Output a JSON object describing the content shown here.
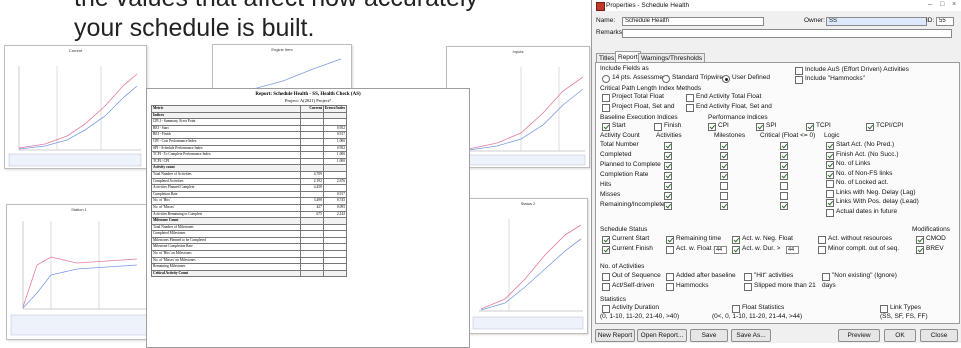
{
  "slide": {
    "title_partial": "your schedule is built.",
    "title_cut": "the values that affect how accurately"
  },
  "thumbnails": [
    {
      "title": "Current"
    },
    {
      "title": "Engine Item"
    },
    {
      "title": "Inputs"
    },
    {
      "title": "Station 1"
    },
    {
      "title": "Status 2"
    }
  ],
  "report": {
    "title": "Report: Schedule Health - SS, Health Check (AS)",
    "subtitle": "Project: A(2021) Project?",
    "col_metric": "Metric",
    "col_current": "Current",
    "col_prev": "Errors/Index",
    "rows": [
      {
        "label": "Indices",
        "cur": "",
        "prev": "",
        "sec": true
      },
      {
        "label": "CPLI - Summary, Error Point",
        "cur": "",
        "prev": ""
      },
      {
        "label": "BEI - Start",
        "cur": "",
        "prev": "0.952"
      },
      {
        "label": "BEI - Finish",
        "cur": "",
        "prev": "0.917"
      },
      {
        "label": "CPI - Cost Performance Index",
        "cur": "",
        "prev": "1.000"
      },
      {
        "label": "SPI - Schedule Performance Index",
        "cur": "",
        "prev": "0.952"
      },
      {
        "label": "TCPI - To Complete Performance Index",
        "cur": "",
        "prev": "1.000"
      },
      {
        "label": "TCPI / CPI",
        "cur": "",
        "prev": "1.000"
      },
      {
        "label": "Activity count",
        "cur": "",
        "prev": "",
        "sec": true
      },
      {
        "label": "Total Number of Activities",
        "cur": "4,709",
        "prev": ""
      },
      {
        "label": "Completed Activities",
        "cur": "2,192",
        "prev": "2,676"
      },
      {
        "label": "Activities Planned Complete",
        "cur": "4,458",
        "prev": ""
      },
      {
        "label": "Completion Rate",
        "cur": "",
        "prev": "0.917"
      },
      {
        "label": "No. of 'Hits'",
        "cur": "3,498",
        "prev": "0.745"
      },
      {
        "label": "No. of 'Misses'",
        "cur": "427",
        "prev": "0.095"
      },
      {
        "label": "Activities Remaining to Complete",
        "cur": "675",
        "prev": "2,142"
      },
      {
        "label": "Milestone Count",
        "cur": "",
        "prev": "",
        "sec": true
      },
      {
        "label": "Total Number of Milestones",
        "cur": "",
        "prev": ""
      },
      {
        "label": "Completed Milestones",
        "cur": "",
        "prev": ""
      },
      {
        "label": "Milestones Planned to be Completed",
        "cur": "",
        "prev": ""
      },
      {
        "label": "Milestone Completion Rate",
        "cur": "",
        "prev": ""
      },
      {
        "label": "No. of 'Hits' on Milestones",
        "cur": "",
        "prev": ""
      },
      {
        "label": "No. of 'Misses' on Milestones",
        "cur": "",
        "prev": ""
      },
      {
        "label": "Remaining Milestones",
        "cur": "",
        "prev": ""
      },
      {
        "label": "Critical Activity Count",
        "cur": "",
        "prev": "",
        "sec": true
      }
    ]
  },
  "window": {
    "title": "Properties - Schedule Health",
    "name_label": "Name:",
    "name_value": "Schedule Health",
    "owner_label": "Owner:",
    "owner_value": "SS",
    "id_label": "ID:",
    "id_value": "55",
    "remarks_label": "Remarks:",
    "tabs": [
      "Titles",
      "Report",
      "Warnings/Thresholds"
    ],
    "include_fields_label": "Include Fields as",
    "radio_options": [
      "14 pts. Assessment",
      "Standard Tripwire",
      "User Defined"
    ],
    "include_aus_label": "Include AuS (Effort Driven) Activities",
    "include_hammocks_label": "Include \"Hammocks\"",
    "critical_path_label": "Critical Path Length Index Methods",
    "cp_options": [
      "Project Total Float",
      "End Activity Total Float",
      "Project Float, Set and",
      "End Activity Float, Set and"
    ],
    "baseline_label": "Baseline Execution Indices",
    "performance_label": "Performance Indices",
    "indices": [
      "Start",
      "Finish",
      "CPI",
      "SPI",
      "TCPI",
      "TCPI/CPI"
    ],
    "activity_count_label": "Activity Count",
    "col_activities": "Activities",
    "col_milestones": "Milestones",
    "col_critical": "Critical (Float <= 0)",
    "counts_rows": [
      "Total Number",
      "Completed",
      "Planned to Complete",
      "Completion Rate",
      "Hits",
      "Misses",
      "Remaining/Incomplete"
    ],
    "logic_label": "Logic",
    "logic_items": [
      "Start Act. (No Pred.)",
      "Finish Act. (No Succ.)",
      "No. of Links",
      "No. of Non-FS links",
      "No. of Locked act.",
      "Links with Neg. Delay (Lag)",
      "Links With Pos. delay (Lead)",
      "Actual dates in future"
    ],
    "schedule_status_label": "Schedule Status",
    "modifications_label": "Modifications",
    "status_items": [
      "Current Start",
      "Remaining time",
      "Act. w. Neg. Float",
      "Act. without resources",
      "Current Finish",
      "Act. w. Float >",
      "Act. w. Dur. >",
      "Minor complt. out of seq."
    ],
    "float_value": "44",
    "dur_value": "44",
    "mod_items": [
      "CMOD",
      "BREV"
    ],
    "no_activities_label": "No. of Activities",
    "noact_items": [
      "Out of Sequence",
      "Added after baseline",
      "\"Hit\" activities",
      "\"Non existing\" (Ignore)",
      "Act/Self-driven",
      "Hammocks",
      "Slipped more than 21",
      "days"
    ],
    "statistics_label": "Statistics",
    "stat_items": [
      "Activity Duration",
      "Float Statistics",
      "Link Types"
    ],
    "stat_ranges": [
      "(0, 1-10, 11-20, 21-40, >40)",
      "(0<, 0, 1-10, 11-20, 21-44, >44)",
      "(SS, SF, FS, FF)"
    ],
    "buttons_left": [
      "New Report",
      "Open Report...",
      "Save",
      "Save As..."
    ],
    "buttons_right": [
      "Preview",
      "OK",
      "Close"
    ]
  }
}
